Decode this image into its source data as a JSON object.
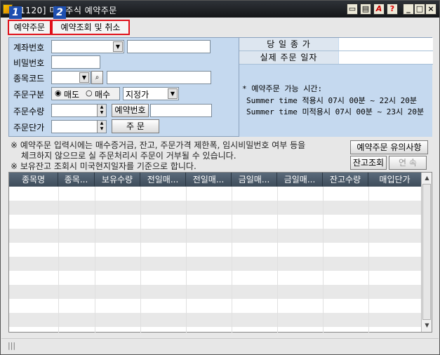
{
  "window": {
    "title": "[1120] 미국주식 예약주문",
    "controls": [
      "window-icon",
      "lock-icon",
      "font-icon",
      "help-icon",
      "minimize-icon",
      "maximize-icon",
      "close-icon"
    ],
    "help_label": "?",
    "font_label": "A"
  },
  "markers": [
    "1",
    "2"
  ],
  "tabs": [
    {
      "label": "예약주문",
      "active": true
    },
    {
      "label": "예약조회 및 취소",
      "active": false
    }
  ],
  "form": {
    "account_label": "계좌번호",
    "password_label": "비밀번호",
    "stock_code_label": "종목코드",
    "order_type_label": "주문구분",
    "sell_label": "매도",
    "buy_label": "매수",
    "price_type_value": "지정가",
    "order_qty_label": "주문수량",
    "reserve_no_label": "예약번호",
    "order_price_label": "주문단가",
    "order_button": "주  문"
  },
  "info": {
    "prev_close_label": "당 일 종 가",
    "actual_order_date_label": "실제 주문 일자",
    "hours_title": "* 예약주문 가능 시간:",
    "summer_applied": "Summer time 적용시  07시 00분 ~ 22시 20분",
    "summer_not_applied": "Summer time 미적용시 07시 00분 ~ 23시 20분"
  },
  "notes": {
    "line1": "※ 예약주문 입력시에는 매수증거금, 잔고, 주문가격 제한폭, 임시비밀번호 여부 등을",
    "line2": "체크하지 않으므로 실 주문처리시 주문이 거부될 수 있습니다.",
    "line3": "※ 보유잔고 조회시 미국현지일자를 기준으로 합니다.",
    "caution_button": "예약주문 유의사항",
    "balance_button": "잔고조회",
    "continue_button": "연  속"
  },
  "table": {
    "columns": [
      "종목명",
      "종목...",
      "보유수량",
      "전일매...",
      "전일매...",
      "금일매...",
      "금일매...",
      "잔고수량",
      "매입단가"
    ]
  },
  "status": {
    "grip": "|||"
  },
  "colors": {
    "tab_highlight": "#e0101a",
    "marker": "#1e4fb0",
    "panel": "#c5d9ef",
    "header": "#4a5968"
  }
}
